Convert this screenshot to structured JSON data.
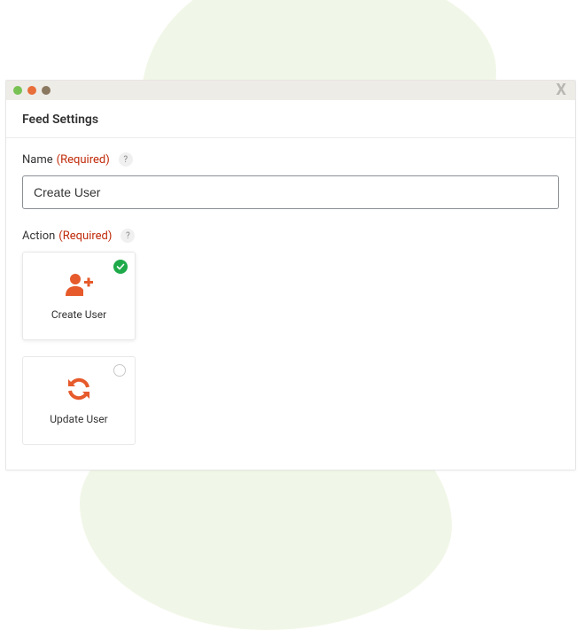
{
  "header": {
    "title": "Feed Settings"
  },
  "fields": {
    "name": {
      "label": "Name",
      "required_text": "(Required)",
      "help": "?",
      "value": "Create User"
    },
    "action": {
      "label": "Action",
      "required_text": "(Required)",
      "help": "?",
      "options": [
        {
          "label": "Create User",
          "selected": true,
          "icon": "user-plus-icon"
        },
        {
          "label": "Update User",
          "selected": false,
          "icon": "refresh-icon"
        }
      ]
    }
  },
  "colors": {
    "accent": "#e65a2b",
    "success": "#1faa4a",
    "required": "#c02b0a"
  }
}
